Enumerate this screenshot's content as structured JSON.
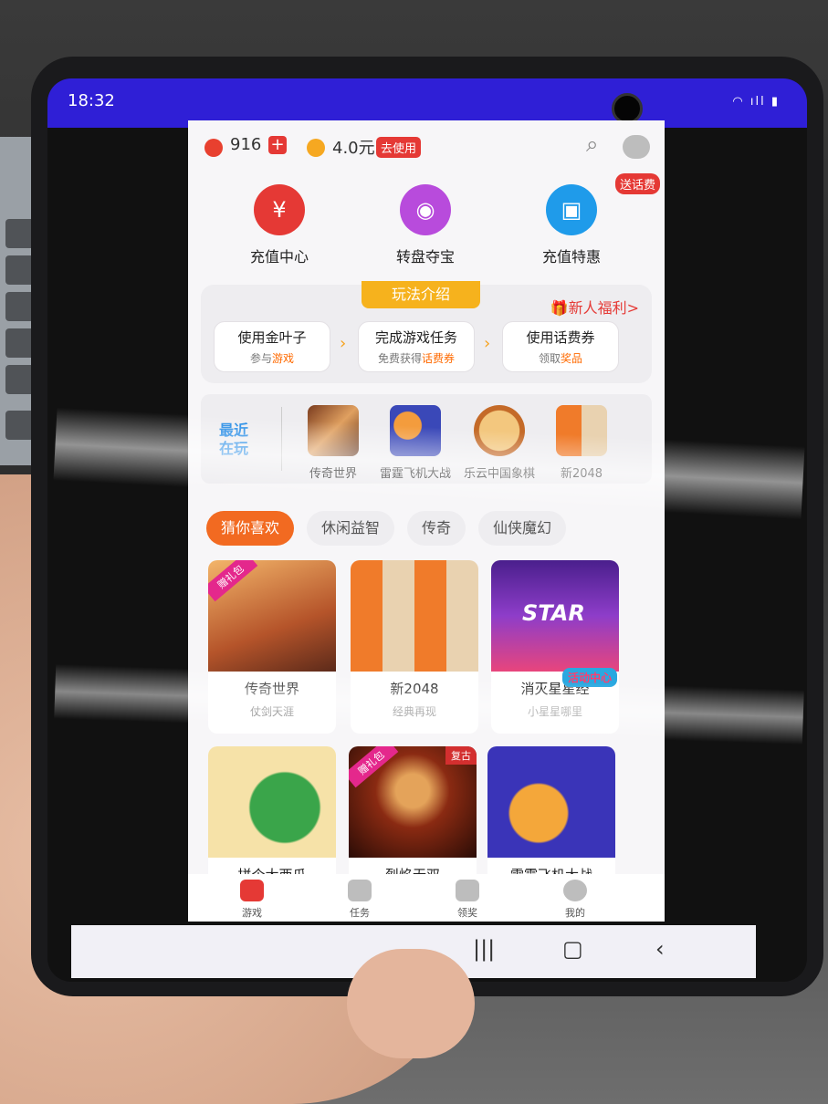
{
  "status": {
    "time": "18:32"
  },
  "top": {
    "leaf_count": "916",
    "balance": "4.0元",
    "use_label": "去使用",
    "gift_badge": "送话费"
  },
  "features": [
    {
      "label": "充值中心",
      "color": "#e53935"
    },
    {
      "label": "转盘夺宝",
      "color": "#b84bdc"
    },
    {
      "label": "充值特惠",
      "color": "#1f9bea"
    }
  ],
  "how_to": {
    "header": "玩法介绍",
    "newbie": "新人福利>",
    "steps": [
      {
        "title": "使用金叶子",
        "prefix": "参与",
        "highlight": "游戏"
      },
      {
        "title": "完成游戏任务",
        "prefix": "免费获得",
        "highlight": "话费券"
      },
      {
        "title": "使用话费券",
        "prefix": "领取",
        "highlight": "奖品"
      }
    ]
  },
  "recent": {
    "label_line1": "最近",
    "label_line2": "在玩",
    "games": [
      "传奇世界",
      "雷霆飞机大战",
      "乐云中国象棋",
      "新2048"
    ]
  },
  "tabs": [
    "猜你喜欢",
    "休闲益智",
    "传奇",
    "仙侠魔幻"
  ],
  "cards": [
    {
      "title": "传奇世界",
      "subtitle": "仗剑天涯",
      "ribbon": "赠礼包"
    },
    {
      "title": "新2048",
      "subtitle": "经典再现",
      "ribbon": ""
    },
    {
      "title": "消灭星星经",
      "subtitle": "小星星哪里",
      "ribbon": "",
      "overlay": "活动中心"
    },
    {
      "title": "拼个大西瓜",
      "subtitle": "",
      "ribbon": ""
    },
    {
      "title": "烈焰无双",
      "subtitle": "",
      "ribbon": "赠礼包",
      "corner": "复古"
    },
    {
      "title": "雷霆飞机大战",
      "subtitle": "",
      "ribbon": ""
    }
  ],
  "bottom_nav": [
    "游戏",
    "任务",
    "领奖",
    "我的"
  ]
}
